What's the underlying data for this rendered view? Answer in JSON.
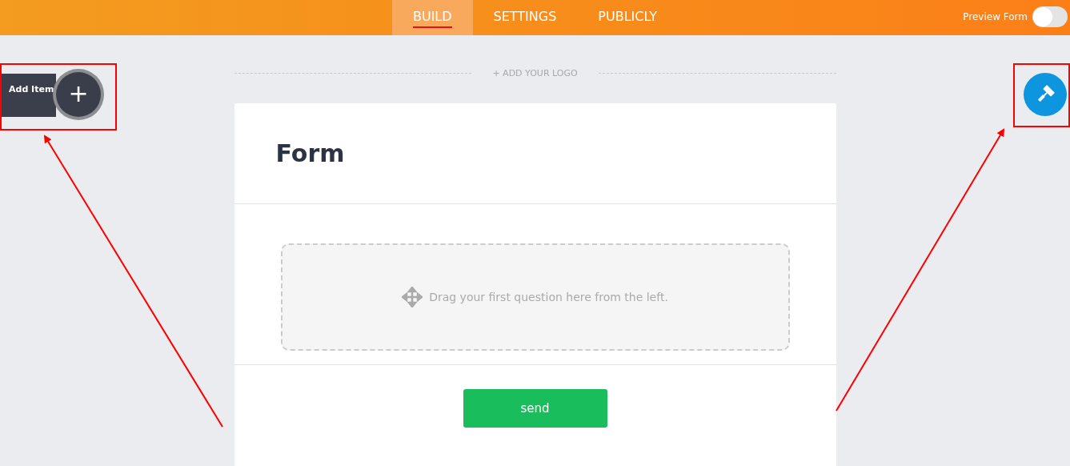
{
  "header": {
    "tabs": [
      {
        "label": "BUILD",
        "selected": true
      },
      {
        "label": "SETTINGS",
        "selected": false
      },
      {
        "label": "PUBLICLY",
        "selected": false
      }
    ],
    "preview": {
      "label": "Preview Form",
      "on": false
    }
  },
  "add_item": {
    "label": "Add Item",
    "icon": "+"
  },
  "logo_placeholder": "+ ADD YOUR LOGO",
  "form": {
    "title": "Form",
    "dropzone_text": "Drag your first question here from the left.",
    "submit": "send"
  }
}
